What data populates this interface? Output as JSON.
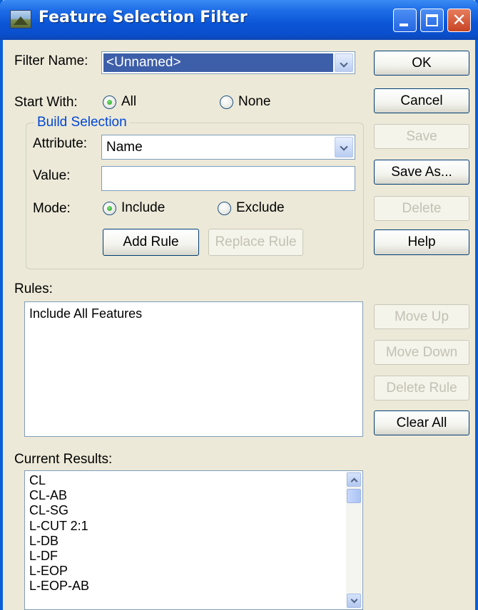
{
  "window": {
    "title": "Feature Selection Filter",
    "icon": "terrain-app-icon"
  },
  "titlebar_buttons": {
    "minimize_icon": "minimize-icon",
    "maximize_icon": "maximize-icon",
    "close_icon": "close-icon"
  },
  "filter_name": {
    "label": "Filter Name:",
    "value": "<Unnamed>"
  },
  "start_with": {
    "label": "Start With:",
    "options": [
      {
        "label": "All",
        "selected": true
      },
      {
        "label": "None",
        "selected": false
      }
    ]
  },
  "build_selection": {
    "legend": "Build Selection",
    "attribute": {
      "label": "Attribute:",
      "value": "Name"
    },
    "value": {
      "label": "Value:",
      "text": ""
    },
    "mode": {
      "label": "Mode:",
      "options": [
        {
          "label": "Include",
          "selected": true
        },
        {
          "label": "Exclude",
          "selected": false
        }
      ]
    },
    "add_rule": "Add Rule",
    "replace_rule": "Replace Rule"
  },
  "side_buttons": {
    "ok": "OK",
    "cancel": "Cancel",
    "save": "Save",
    "save_as": "Save As...",
    "delete": "Delete",
    "help": "Help"
  },
  "rules": {
    "label": "Rules:",
    "items": [
      "Include All Features"
    ],
    "move_up": "Move Up",
    "move_down": "Move Down",
    "delete_rule": "Delete Rule",
    "clear_all": "Clear All"
  },
  "current_results": {
    "label": "Current Results:",
    "items": [
      "CL",
      "CL-AB",
      "CL-SG",
      "L-CUT 2:1",
      "L-DB",
      "L-DF",
      "L-EOP",
      "L-EOP-AB"
    ]
  },
  "colors": {
    "title_bar": "#0a55d6",
    "dialog_bg": "#ece9d8",
    "selection": "#3d5ea8",
    "group_title": "#0046d5"
  }
}
